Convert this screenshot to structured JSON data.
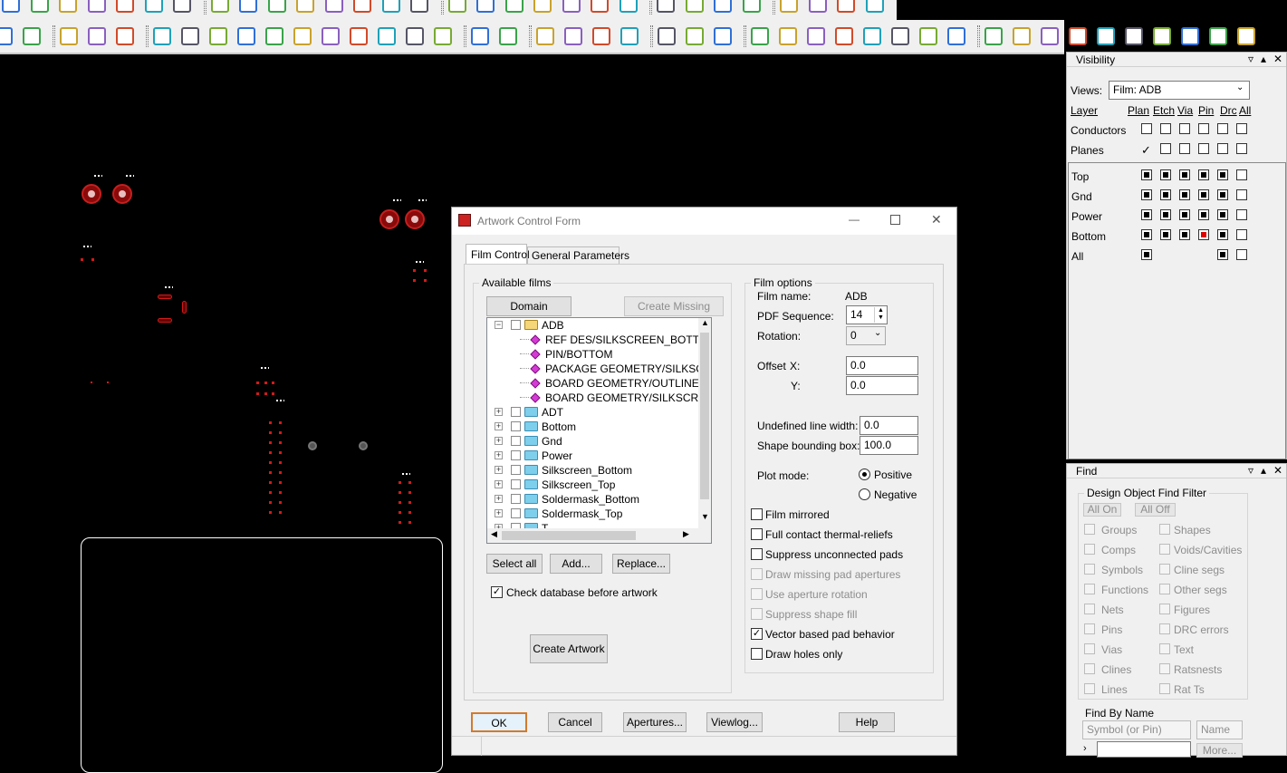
{
  "dialog": {
    "title": "Artwork Control Form",
    "tabs": [
      "Film Control",
      "General Parameters"
    ],
    "available_films": {
      "label": "Available films",
      "domain_selection": "Domain Selection",
      "create_missing": "Create Missing Films",
      "tree": [
        {
          "name": "ADB",
          "type": "folder-open"
        },
        {
          "name": "REF DES/SILKSCREEN_BOTTOM",
          "type": "layer"
        },
        {
          "name": "PIN/BOTTOM",
          "type": "layer"
        },
        {
          "name": "PACKAGE GEOMETRY/SILKSCREEN_BOTTOM",
          "type": "layer"
        },
        {
          "name": "BOARD GEOMETRY/OUTLINE",
          "type": "layer"
        },
        {
          "name": "BOARD GEOMETRY/SILKSCREEN_BOTTOM",
          "type": "layer"
        },
        {
          "name": "ADT",
          "type": "folder"
        },
        {
          "name": "Bottom",
          "type": "folder"
        },
        {
          "name": "Gnd",
          "type": "folder"
        },
        {
          "name": "Power",
          "type": "folder"
        },
        {
          "name": "Silkscreen_Bottom",
          "type": "folder"
        },
        {
          "name": "Silkscreen_Top",
          "type": "folder"
        },
        {
          "name": "Soldermask_Bottom",
          "type": "folder"
        },
        {
          "name": "Soldermask_Top",
          "type": "folder"
        },
        {
          "name": "T",
          "type": "folder"
        }
      ],
      "select_all": "Select all",
      "add": "Add...",
      "replace": "Replace...",
      "check_db": "Check database before artwork",
      "create_artwork": "Create Artwork"
    },
    "film_options": {
      "label": "Film options",
      "film_name_label": "Film name:",
      "film_name": "ADB",
      "pdf_seq_label": "PDF Sequence:",
      "pdf_seq": "14",
      "rotation_label": "Rotation:",
      "rotation": "0",
      "offset_label": "Offset",
      "x_label": "X:",
      "x_value": "0.0",
      "y_label": "Y:",
      "y_value": "0.0",
      "undef_label": "Undefined line width:",
      "undef_value": "0.0",
      "shape_label": "Shape bounding box:",
      "shape_value": "100.0",
      "plot_mode_label": "Plot mode:",
      "positive": "Positive",
      "negative": "Negative",
      "options": [
        {
          "label": "Film mirrored",
          "checked": false,
          "enabled": true
        },
        {
          "label": "Full contact thermal-reliefs",
          "checked": false,
          "enabled": true
        },
        {
          "label": "Suppress unconnected pads",
          "checked": false,
          "enabled": true
        },
        {
          "label": "Draw missing pad apertures",
          "checked": false,
          "enabled": false
        },
        {
          "label": "Use aperture rotation",
          "checked": false,
          "enabled": false
        },
        {
          "label": "Suppress shape fill",
          "checked": false,
          "enabled": false
        },
        {
          "label": "Vector based pad behavior",
          "checked": true,
          "enabled": true
        },
        {
          "label": "Draw holes only",
          "checked": false,
          "enabled": true
        }
      ]
    },
    "footer": {
      "ok": "OK",
      "cancel": "Cancel",
      "apertures": "Apertures...",
      "viewlog": "Viewlog...",
      "help": "Help"
    }
  },
  "visibility": {
    "title": "Visibility",
    "views_label": "Views:",
    "views_value": "Film: ADB",
    "columns": [
      "Layer",
      "Plan",
      "Etch",
      "Via",
      "Pin",
      "Drc",
      "All"
    ],
    "rows_top": [
      "Conductors",
      "Planes"
    ],
    "layers": [
      "Top",
      "Gnd",
      "Power",
      "Bottom",
      "All"
    ]
  },
  "find": {
    "title": "Find",
    "filter_label": "Design Object Find Filter",
    "all_on": "All On",
    "all_off": "All Off",
    "left": [
      "Groups",
      "Comps",
      "Symbols",
      "Functions",
      "Nets",
      "Pins",
      "Vias",
      "Clines",
      "Lines"
    ],
    "right": [
      "Shapes",
      "Voids/Cavities",
      "Cline segs",
      "Other segs",
      "Figures",
      "DRC errors",
      "Text",
      "Ratsnests",
      "Rat Ts"
    ],
    "by_name_label": "Find By Name",
    "type_value": "Symbol (or Pin)",
    "name_value": "Name",
    "more": "More..."
  },
  "canvas_labels": {
    "silk": "R182 01 02"
  },
  "dialog_buttons": {
    "min": "—",
    "max": "☐",
    "close": "✕"
  },
  "panel_controls": {
    "pin": "▿",
    "float": "▴",
    "close": "✕"
  }
}
